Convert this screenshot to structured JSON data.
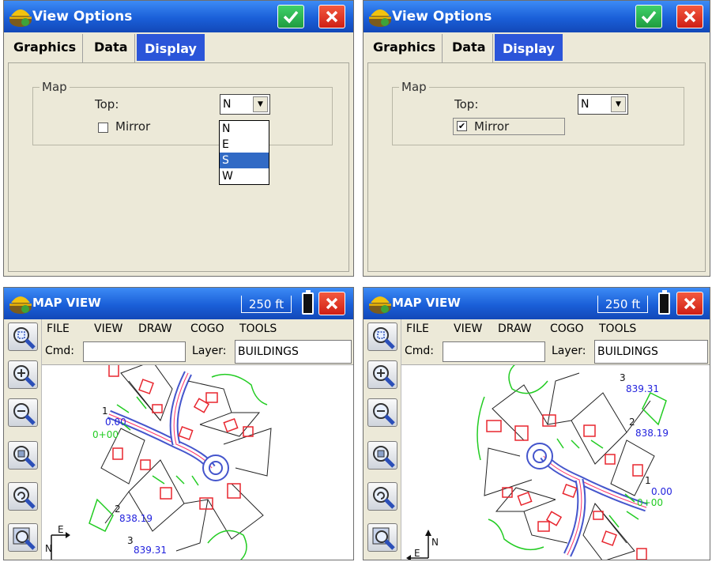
{
  "dialog_left": {
    "title": "View Options",
    "tabs": [
      "Graphics",
      "Data",
      "Display"
    ],
    "group_label": "Map",
    "top_label": "Top:",
    "top_value": "N",
    "mirror_label": "Mirror",
    "mirror_checked": false,
    "dropdown_open": true,
    "dropdown_options": [
      "N",
      "E",
      "S",
      "W"
    ],
    "dropdown_highlighted": "S"
  },
  "dialog_right": {
    "title": "View Options",
    "tabs": [
      "Graphics",
      "Data",
      "Display"
    ],
    "group_label": "Map",
    "top_label": "Top:",
    "top_value": "N",
    "mirror_label": "Mirror",
    "mirror_checked": true,
    "dropdown_open": false
  },
  "map_left": {
    "title": "MAP VIEW",
    "scale": "250 ft",
    "menu": [
      "FILE",
      "VIEW",
      "DRAW",
      "COGO",
      "TOOLS"
    ],
    "cmd_label": "Cmd:",
    "layer_label": "Layer:",
    "layer_value": "BUILDINGS",
    "points": [
      {
        "num": "1",
        "elev": "0.00"
      },
      {
        "num": "2",
        "elev": "838.19"
      },
      {
        "num": "3",
        "elev": "839.31"
      }
    ],
    "station": "0+00",
    "north": "N",
    "east": "E"
  },
  "map_right": {
    "title": "MAP VIEW",
    "scale": "250 ft",
    "menu": [
      "FILE",
      "VIEW",
      "DRAW",
      "COGO",
      "TOOLS"
    ],
    "cmd_label": "Cmd:",
    "layer_label": "Layer:",
    "layer_value": "BUILDINGS",
    "points": [
      {
        "num": "1",
        "elev": "0.00"
      },
      {
        "num": "2",
        "elev": "838.19"
      },
      {
        "num": "3",
        "elev": "839.31"
      }
    ],
    "station": "0+00",
    "north": "N",
    "east": "E"
  },
  "colors": {
    "titlebar": "#1a5fd8",
    "ok": "#1f9c3f",
    "close": "#cf1f15",
    "tab_active": "#2b55d9",
    "dialog_bg": "#ece9d8",
    "buildings": "#e8262f",
    "contours": "#22cc22",
    "labels": "#2222dd"
  }
}
